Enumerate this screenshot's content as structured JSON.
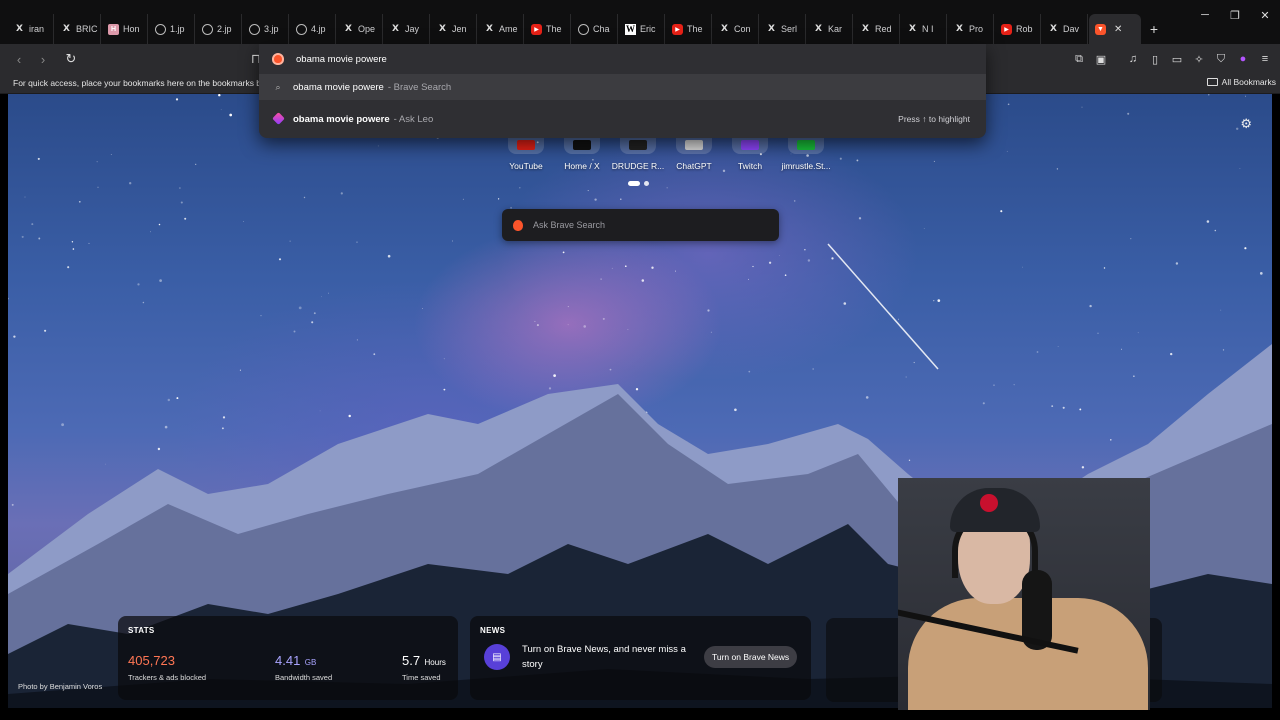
{
  "tabs": [
    {
      "icon": "x",
      "label": "iran"
    },
    {
      "icon": "x",
      "label": "BRIC"
    },
    {
      "icon": "pink",
      "label": "Hon"
    },
    {
      "icon": "globe",
      "label": "1.jp"
    },
    {
      "icon": "globe",
      "label": "2.jp"
    },
    {
      "icon": "globe",
      "label": "3.jp"
    },
    {
      "icon": "globe",
      "label": "4.jp"
    },
    {
      "icon": "x",
      "label": "Ope"
    },
    {
      "icon": "x",
      "label": "Jay"
    },
    {
      "icon": "x",
      "label": "Jen"
    },
    {
      "icon": "x",
      "label": "Ame"
    },
    {
      "icon": "yt",
      "label": "The"
    },
    {
      "icon": "globe",
      "label": "Cha"
    },
    {
      "icon": "w",
      "label": "Eric"
    },
    {
      "icon": "yt",
      "label": "The"
    },
    {
      "icon": "x",
      "label": "Con"
    },
    {
      "icon": "x",
      "label": "Serl"
    },
    {
      "icon": "x",
      "label": "Kar"
    },
    {
      "icon": "x",
      "label": "Red"
    },
    {
      "icon": "x",
      "label": "N I"
    },
    {
      "icon": "x",
      "label": "Pro"
    },
    {
      "icon": "yt",
      "label": "Rob"
    },
    {
      "icon": "x",
      "label": "Dav"
    }
  ],
  "omnibox": {
    "value": "obama movie powere",
    "suggestions": [
      {
        "query": "obama movie powere",
        "source": "- Brave Search"
      },
      {
        "query": "obama movie powere",
        "source": "- Ask Leo",
        "hint": "Press ↑ to highlight"
      }
    ]
  },
  "bookmarks_bar": {
    "hint": "For quick access, place your bookmarks here on the bookmarks bar.",
    "all_bookmarks": "All Bookmarks"
  },
  "top_sites": [
    {
      "label": "YouTube",
      "color": "#e62117"
    },
    {
      "label": "Home / X",
      "color": "#111111"
    },
    {
      "label": "DRUDGE R...",
      "color": "#222222"
    },
    {
      "label": "ChatGPT",
      "color": "#dddddd"
    },
    {
      "label": "Twitch",
      "color": "#9146ff"
    },
    {
      "label": "jimrustle.St...",
      "color": "#19c23a"
    }
  ],
  "ntp_search": {
    "placeholder": "Ask Brave Search"
  },
  "stats": {
    "title": "STATS",
    "trackers": {
      "value": "405,723",
      "label": "Trackers & ads blocked"
    },
    "bandwidth": {
      "value": "4.41",
      "unit": "GB",
      "label": "Bandwidth saved"
    },
    "time": {
      "value": "5.7",
      "unit": "Hours",
      "label": "Time saved"
    }
  },
  "news": {
    "title": "NEWS",
    "text": "Turn on Brave News, and never miss a story",
    "button": "Turn on Brave News"
  },
  "credit": "Photo by Benjamin Voros",
  "colors": {
    "brave_orange": "#fb542b",
    "tab_bg": "#0f0f10",
    "toolbar_bg": "#2b2b2e"
  }
}
